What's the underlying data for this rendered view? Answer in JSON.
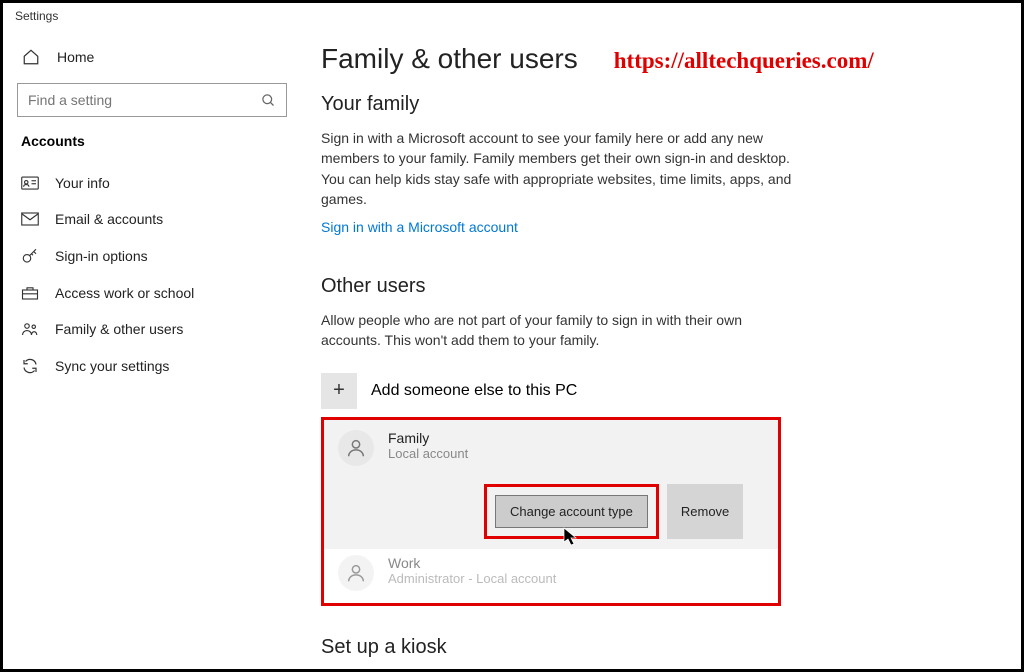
{
  "window": {
    "title": "Settings"
  },
  "sidebar": {
    "home": "Home",
    "searchPlaceholder": "Find a setting",
    "category": "Accounts",
    "items": [
      {
        "label": "Your info"
      },
      {
        "label": "Email & accounts"
      },
      {
        "label": "Sign-in options"
      },
      {
        "label": "Access work or school"
      },
      {
        "label": "Family & other users"
      },
      {
        "label": "Sync your settings"
      }
    ]
  },
  "main": {
    "title": "Family & other users",
    "watermark": "https://alltechqueries.com/",
    "family": {
      "title": "Your family",
      "desc": "Sign in with a Microsoft account to see your family here or add any new members to your family. Family members get their own sign-in and desktop. You can help kids stay safe with appropriate websites, time limits, apps, and games.",
      "link": "Sign in with a Microsoft account"
    },
    "other": {
      "title": "Other users",
      "desc": "Allow people who are not part of your family to sign in with their own accounts. This won't add them to your family.",
      "addLabel": "Add someone else to this PC",
      "users": [
        {
          "name": "Family",
          "sub": "Local account"
        },
        {
          "name": "Work",
          "sub": "Administrator - Local account"
        }
      ],
      "changeBtn": "Change account type",
      "removeBtn": "Remove"
    },
    "kiosk": {
      "title": "Set up a kiosk"
    }
  }
}
